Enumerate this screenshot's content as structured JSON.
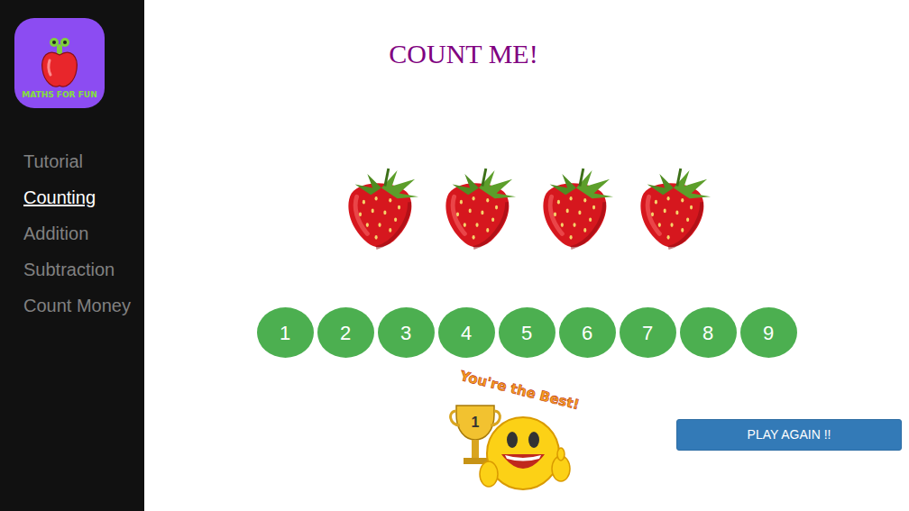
{
  "logo": {
    "text": "MATHS FOR FUN"
  },
  "sidebar": {
    "items": [
      {
        "label": "Tutorial",
        "selected": false
      },
      {
        "label": "Counting",
        "selected": true
      },
      {
        "label": "Addition",
        "selected": false
      },
      {
        "label": "Subtraction",
        "selected": false
      },
      {
        "label": "Count Money",
        "selected": false
      }
    ]
  },
  "game": {
    "title": "COUNT ME!",
    "fruit_count": 4,
    "answers": [
      "1",
      "2",
      "3",
      "4",
      "5",
      "6",
      "7",
      "8",
      "9"
    ]
  },
  "reward": {
    "banner": "You're the Best!",
    "rank": "1"
  },
  "buttons": {
    "play_again": "PLAY AGAIN !!"
  }
}
